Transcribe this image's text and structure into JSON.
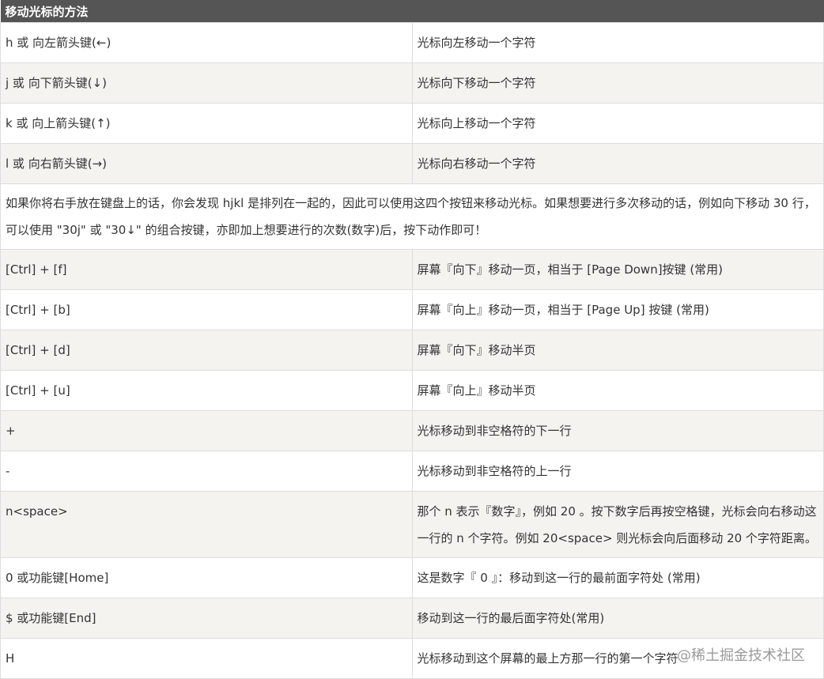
{
  "table": {
    "header": "移动光标的方法",
    "rows_a": [
      {
        "key": "h 或 向左箭头键(←)",
        "desc": "光标向左移动一个字符"
      },
      {
        "key": "j 或 向下箭头键(↓)",
        "desc": "光标向下移动一个字符"
      },
      {
        "key": "k 或 向上箭头键(↑)",
        "desc": "光标向上移动一个字符"
      },
      {
        "key": "l 或 向右箭头键(→)",
        "desc": "光标向右移动一个字符"
      }
    ],
    "note": "如果你将右手放在键盘上的话，你会发现 hjkl 是排列在一起的，因此可以使用这四个按钮来移动光标。如果想要进行多次移动的话，例如向下移动 30 行，可以使用 \"30j\" 或 \"30↓\" 的组合按键，亦即加上想要进行的次数(数字)后，按下动作即可！",
    "rows_b": [
      {
        "key": "[Ctrl] + [f]",
        "desc": "屏幕『向下』移动一页，相当于 [Page Down]按键 (常用)"
      },
      {
        "key": "[Ctrl] + [b]",
        "desc": "屏幕『向上』移动一页，相当于 [Page Up] 按键 (常用)"
      },
      {
        "key": "[Ctrl] + [d]",
        "desc": "屏幕『向下』移动半页"
      },
      {
        "key": "[Ctrl] + [u]",
        "desc": "屏幕『向上』移动半页"
      },
      {
        "key": "+",
        "desc": "光标移动到非空格符的下一行"
      },
      {
        "key": "-",
        "desc": "光标移动到非空格符的上一行"
      },
      {
        "key": "n<space>",
        "desc": "那个 n 表示『数字』，例如 20 。按下数字后再按空格键，光标会向右移动这一行的 n 个字符。例如 20<space> 则光标会向后面移动 20 个字符距离。"
      },
      {
        "key": "0 或功能键[Home]",
        "desc": "这是数字『 0 』：移动到这一行的最前面字符处 (常用)"
      },
      {
        "key": "$ 或功能键[End]",
        "desc": "移动到这一行的最后面字符处(常用)"
      },
      {
        "key": "H",
        "desc": "光标移动到这个屏幕的最上方那一行的第一个字符"
      }
    ]
  },
  "watermark": "@稀土掘金技术社区"
}
